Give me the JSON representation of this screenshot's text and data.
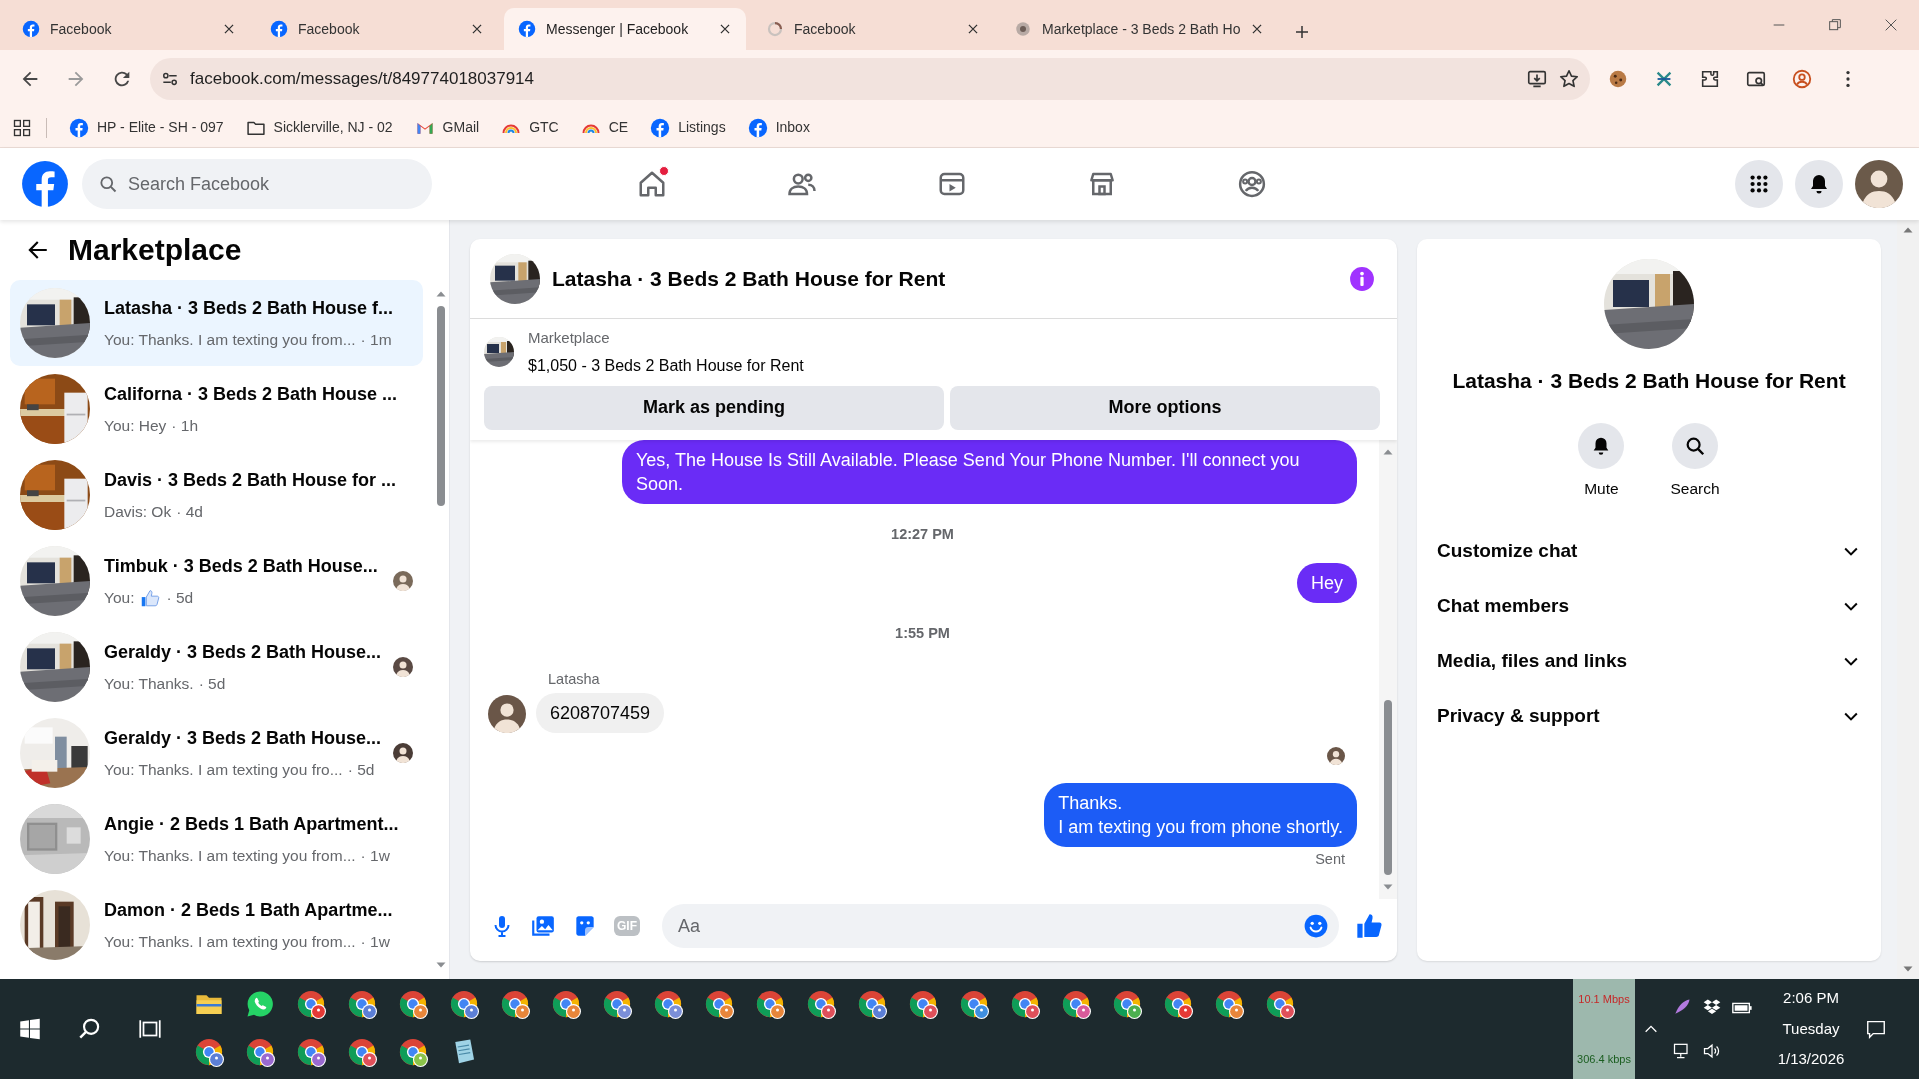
{
  "browser": {
    "tabs": [
      {
        "title": "Facebook",
        "selected": false,
        "kind": "facebook"
      },
      {
        "title": "Facebook",
        "selected": false,
        "kind": "facebook"
      },
      {
        "title": "Messenger | Facebook",
        "selected": true,
        "kind": "facebook"
      },
      {
        "title": "Facebook",
        "selected": false,
        "kind": "spinner"
      },
      {
        "title": "Marketplace - 3 Beds 2 Bath Ho",
        "selected": false,
        "kind": "globe"
      }
    ],
    "address": "facebook.com/messages/t/849774018037914",
    "bookmarks": [
      {
        "label": "HP - Elite - SH - 097",
        "kind": "facebook"
      },
      {
        "label": "Sicklerville, NJ - 02",
        "kind": "folder"
      },
      {
        "label": "GMail",
        "kind": "gmail"
      },
      {
        "label": "GTC",
        "kind": "rainbow"
      },
      {
        "label": "CE",
        "kind": "rainbow"
      },
      {
        "label": "Listings",
        "kind": "facebook"
      },
      {
        "label": "Inbox",
        "kind": "facebook"
      }
    ]
  },
  "facebook": {
    "search": {
      "placeholder": "Search Facebook"
    },
    "nav": [
      {
        "kind": "home",
        "notification": true
      },
      {
        "kind": "friends",
        "notification": false
      },
      {
        "kind": "video",
        "notification": false
      },
      {
        "kind": "marketplace",
        "notification": false
      },
      {
        "kind": "groups",
        "notification": false
      }
    ]
  },
  "sidebar": {
    "title": "Marketplace",
    "conversations": [
      {
        "title": "Latasha · 3 Beds 2 Bath House f...",
        "preview": "You: Thanks. I am texting you from...",
        "time": "· 1m",
        "selected": true,
        "like": false,
        "seen": false
      },
      {
        "title": "Californa · 3 Beds 2 Bath House ...",
        "preview": "You: Hey",
        "time": "· 1h",
        "selected": false,
        "like": false,
        "seen": false
      },
      {
        "title": "Davis · 3 Beds 2 Bath House for ...",
        "preview": "Davis: Ok",
        "time": "· 4d",
        "selected": false,
        "like": false,
        "seen": false
      },
      {
        "title": "Timbuk · 3 Beds 2 Bath House...",
        "preview": "You:",
        "time": "· 5d",
        "selected": false,
        "like": true,
        "seen": true
      },
      {
        "title": "Geraldy · 3 Beds 2 Bath House...",
        "preview": "You: Thanks.",
        "time": "· 5d",
        "selected": false,
        "like": false,
        "seen": true
      },
      {
        "title": "Geraldy · 3 Beds 2 Bath House...",
        "preview": "You: Thanks. I am texting you fro...",
        "time": "· 5d",
        "selected": false,
        "like": false,
        "seen": true
      },
      {
        "title": "Angie · 2 Beds 1 Bath Apartment...",
        "preview": "You: Thanks. I am texting you from...",
        "time": "· 1w",
        "selected": false,
        "like": false,
        "seen": false
      },
      {
        "title": "Damon · 2 Beds 1 Bath Apartme...",
        "preview": "You: Thanks. I am texting you from...",
        "time": "· 1w",
        "selected": false,
        "like": false,
        "seen": false
      }
    ]
  },
  "chat": {
    "title": "Latasha · 3 Beds 2 Bath House for Rent",
    "listing": {
      "label": "Marketplace",
      "text": "$1,050 - 3 Beds 2 Bath House for Rent"
    },
    "actions": [
      "Mark as pending",
      "More options"
    ],
    "messages": [
      {
        "kind": "outgoing",
        "text": "Yes, The House Is Still Available. Please Send Your Phone Number. I'll connect you Soon.",
        "color": "#6a2cf6"
      },
      {
        "kind": "time",
        "text": "12:27 PM"
      },
      {
        "kind": "outgoing",
        "text": "Hey",
        "color": "#6a2cf6"
      },
      {
        "kind": "time",
        "text": "1:55 PM"
      },
      {
        "kind": "incoming",
        "sender": "Latasha",
        "text": "6208707459"
      },
      {
        "kind": "seen"
      },
      {
        "kind": "outgoing",
        "text": "Thanks.\nI am texting you from phone shortly.",
        "color": "#1c5cf6"
      },
      {
        "kind": "status",
        "text": "Sent"
      }
    ],
    "composer": {
      "placeholder": "Aa",
      "gif": "GIF"
    }
  },
  "details": {
    "title": "Latasha · 3 Beds 2 Bath House for Rent",
    "actions": [
      {
        "kind": "mute",
        "label": "Mute"
      },
      {
        "kind": "search",
        "label": "Search"
      }
    ],
    "sections": [
      {
        "label": "Customize chat",
        "expanded": false
      },
      {
        "label": "Chat members",
        "expanded": false
      },
      {
        "label": "Media, files and links",
        "expanded": false
      },
      {
        "label": "Privacy & support",
        "expanded": false
      }
    ]
  },
  "taskbar": {
    "rows": [
      [
        {
          "kind": "folder"
        },
        {
          "kind": "whatsapp"
        },
        {
          "kind": "chrome",
          "color": "#e53935"
        },
        {
          "kind": "chrome",
          "color": "#5c7fd6"
        },
        {
          "kind": "chrome",
          "color": "#e8863a"
        },
        {
          "kind": "chrome",
          "color": "#5c7fd6"
        },
        {
          "kind": "chrome",
          "color": "#e8863a"
        },
        {
          "kind": "chrome",
          "color": "#e8863a"
        },
        {
          "kind": "chrome",
          "color": "#7b8fd8"
        },
        {
          "kind": "chrome",
          "color": "#7b8fd8"
        },
        {
          "kind": "chrome",
          "color": "#e8863a"
        },
        {
          "kind": "chrome",
          "color": "#e8863a"
        },
        {
          "kind": "chrome",
          "color": "#e0505a"
        },
        {
          "kind": "chrome",
          "color": "#5c7fd6"
        },
        {
          "kind": "chrome",
          "color": "#e0505a"
        },
        {
          "kind": "chrome",
          "color": "#3f8fe0"
        },
        {
          "kind": "chrome",
          "color": "#e0505a"
        },
        {
          "kind": "chrome",
          "color": "#d95a9a"
        },
        {
          "kind": "chrome",
          "color": "#4caf50"
        },
        {
          "kind": "chrome",
          "color": "#e53935"
        },
        {
          "kind": "chrome",
          "color": "#e8863a"
        },
        {
          "kind": "chrome",
          "color": "#e0505a"
        }
      ],
      [
        {
          "kind": "chrome",
          "color": "#5c7fd6"
        },
        {
          "kind": "chrome",
          "color": "#9a6ad0"
        },
        {
          "kind": "chrome",
          "color": "#9a6ad0"
        },
        {
          "kind": "chrome",
          "color": "#e0505a"
        },
        {
          "kind": "chrome",
          "color": "#8bc34a"
        },
        {
          "kind": "notes"
        }
      ]
    ],
    "network": {
      "down": "10.1 Mbps",
      "up": "306.4 kbps"
    },
    "clock": {
      "time": "2:06 PM",
      "day": "Tuesday",
      "date": "1/13/2026"
    }
  }
}
